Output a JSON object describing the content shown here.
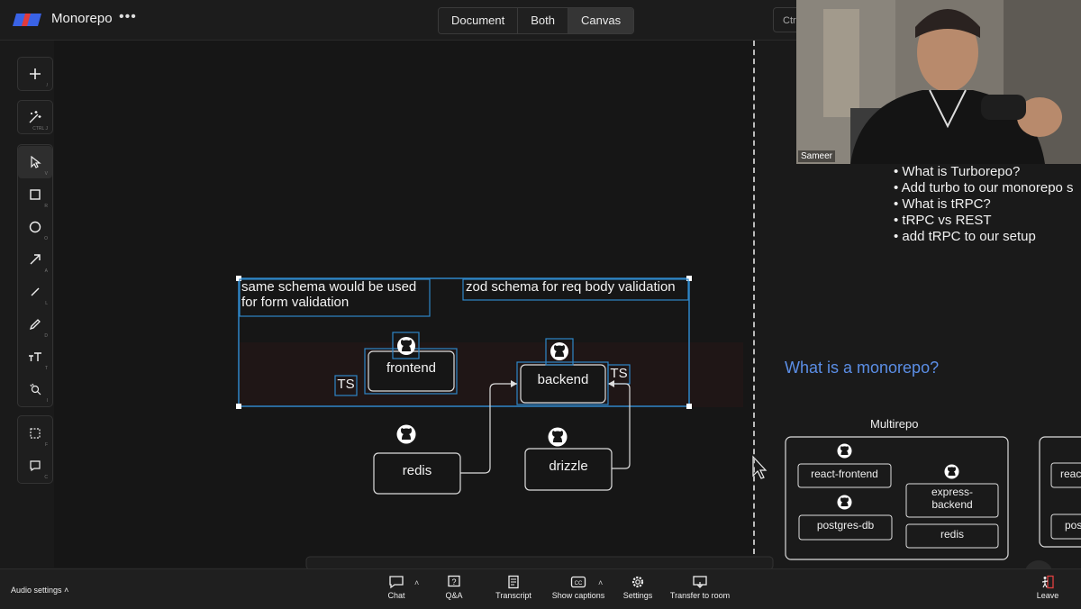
{
  "app": {
    "title": "Monorepo",
    "more_glyph": "•••",
    "logo_colors": [
      "#3a63e6",
      "#e23a3a"
    ]
  },
  "view_switch": {
    "tabs": [
      "Document",
      "Both",
      "Canvas"
    ],
    "active": "Canvas",
    "hint": "Ctrl"
  },
  "toolbar": {
    "groups": [
      [
        {
          "icon": "plus-icon",
          "key": "/"
        }
      ],
      [
        {
          "icon": "magic-wand-icon",
          "key": "CTRL J"
        }
      ],
      [
        {
          "icon": "pointer-icon",
          "key": "V",
          "selected": true
        },
        {
          "icon": "rectangle-icon",
          "key": "R"
        },
        {
          "icon": "circle-icon",
          "key": "O"
        },
        {
          "icon": "arrow-icon",
          "key": "A"
        },
        {
          "icon": "line-icon",
          "key": "L"
        },
        {
          "icon": "pencil-icon",
          "key": "D"
        },
        {
          "icon": "text-icon",
          "key": "T"
        },
        {
          "icon": "image-search-icon",
          "key": "I"
        }
      ],
      [
        {
          "icon": "frame-icon",
          "key": "F"
        },
        {
          "icon": "comment-icon",
          "key": "C"
        }
      ]
    ]
  },
  "canvas": {
    "note_form": "same schema would be used\nfor form validation",
    "note_zod": "zod schema for req body validation",
    "boxes": {
      "frontend": "frontend",
      "backend": "backend",
      "redis": "redis",
      "drizzle": "drizzle"
    },
    "ts_labels": [
      "TS",
      "TS"
    ],
    "selection_color": "#2f86c8"
  },
  "video": {
    "participant": "Sameer"
  },
  "agenda": [
    "• What is Turborepo?",
    "• Add turbo to our monorepo s",
    "• What is tRPC?",
    "• tRPC vs REST",
    "• add tRPC to our setup"
  ],
  "monorepo_section": {
    "heading": "What is a monorepo?",
    "multirepo_label": "Multirepo",
    "repos": [
      "react-frontend",
      "postgres-db",
      "express-\nbackend",
      "redis"
    ],
    "peek_repos": [
      "reac",
      "pos"
    ],
    "accent": "#5b8ee6"
  },
  "bottom_bar": {
    "audio_settings": "Audio settings",
    "items": [
      "Chat",
      "Q&A",
      "Transcript",
      "Show captions",
      "Settings",
      "Transfer to room"
    ],
    "leave": "Leave"
  }
}
